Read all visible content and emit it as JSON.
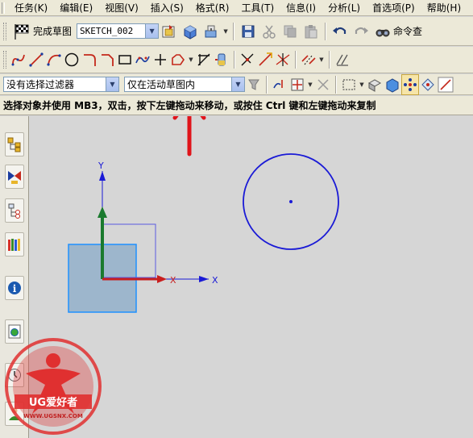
{
  "menubar": {
    "items": [
      "任务(K)",
      "编辑(E)",
      "视图(V)",
      "插入(S)",
      "格式(R)",
      "工具(T)",
      "信息(I)",
      "分析(L)",
      "首选项(P)",
      "帮助(H)"
    ]
  },
  "toolbar1": {
    "finish_sketch_label": "完成草图",
    "sketch_name": "SKETCH_002",
    "command_finder_label": "命令查"
  },
  "selection_bar": {
    "type_filter": "没有选择过滤器",
    "scope": "仅在活动草图内"
  },
  "cue_line": {
    "text": "选择对象并使用 MB3，双击，按下左键拖动来移动，或按住 Ctrl 键和左键拖动来复制"
  },
  "graphics": {
    "axis_labels": {
      "y": "Y",
      "x_sketch": "X",
      "x_wcs": "X"
    },
    "colors": {
      "circle": "#1a1ad6",
      "sketch_plane": "#9db6cc",
      "annotation_arrow": "#e0141a",
      "y_axis": "#1a7a2e",
      "x_axis": "#c81e1e",
      "wcs_axis": "#1a1ad6"
    }
  },
  "resource_bar": {
    "icons": [
      "assembly-navigator-icon",
      "constraint-navigator-icon",
      "part-navigator-icon",
      "reuse-library-icon",
      "info-icon",
      "web-browser-icon",
      "history-icon",
      "roles-icon"
    ]
  },
  "watermark": {
    "brand": "UG爱好者",
    "url": "WWW.UGSNX.COM"
  }
}
